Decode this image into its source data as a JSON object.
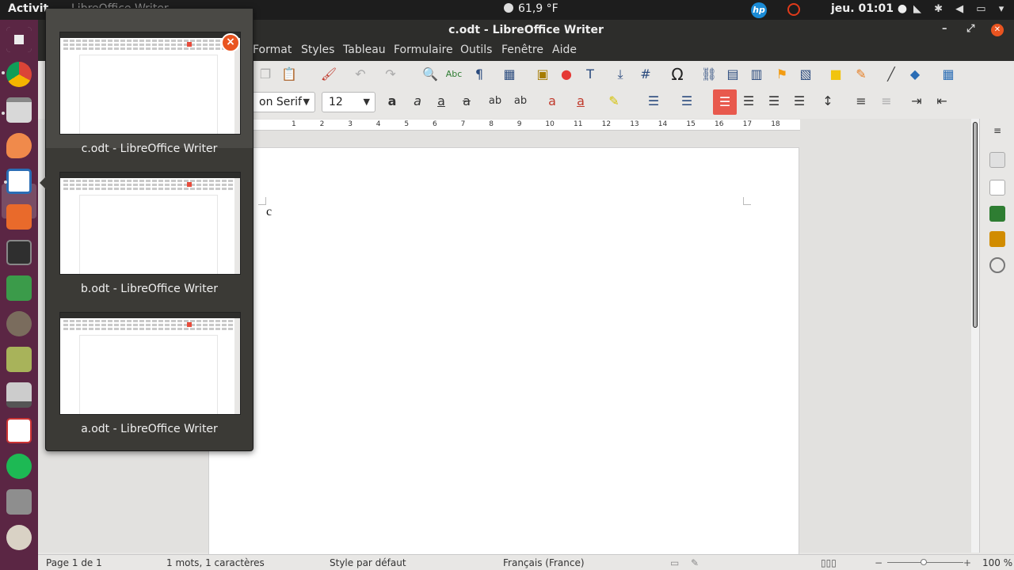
{
  "topbar": {
    "activities": "Activit",
    "app_ghost": "LibreOffice Writer",
    "weather": "61,9 °F",
    "hp": "hp",
    "clock": "jeu. 01:01 ●",
    "tray": "◣ ✱ ◀ ▭ ▾"
  },
  "window": {
    "title": "c.odt - LibreOffice Writer",
    "min": "–",
    "max": "⤢",
    "close": "✕"
  },
  "menu": [
    "Format",
    "Styles",
    "Tableau",
    "Formulaire",
    "Outils",
    "Fenêtre",
    "Aide"
  ],
  "toolbar": {
    "font_name": "on Serif",
    "font_size": "12"
  },
  "ruler_marks": [
    "1",
    "2",
    "3",
    "4",
    "5",
    "6",
    "7",
    "8",
    "9",
    "10",
    "11",
    "12",
    "13",
    "14",
    "15",
    "16",
    "17",
    "18"
  ],
  "document": {
    "text": "c"
  },
  "statusbar": {
    "page": "Page 1 de 1",
    "words": "1 mots, 1 caractères",
    "style": "Style par défaut",
    "language": "Français (France)",
    "zoom": "100 %"
  },
  "switcher": {
    "windows": [
      {
        "label": "c.odt - LibreOffice Writer",
        "selected": true
      },
      {
        "label": "b.odt - LibreOffice Writer",
        "selected": false
      },
      {
        "label": "a.odt - LibreOffice Writer",
        "selected": false
      }
    ],
    "close_icon": "close-icon"
  },
  "colors": {
    "accent": "#e95420",
    "dock": "#5b2644",
    "highlight_align": "#e8594d"
  }
}
